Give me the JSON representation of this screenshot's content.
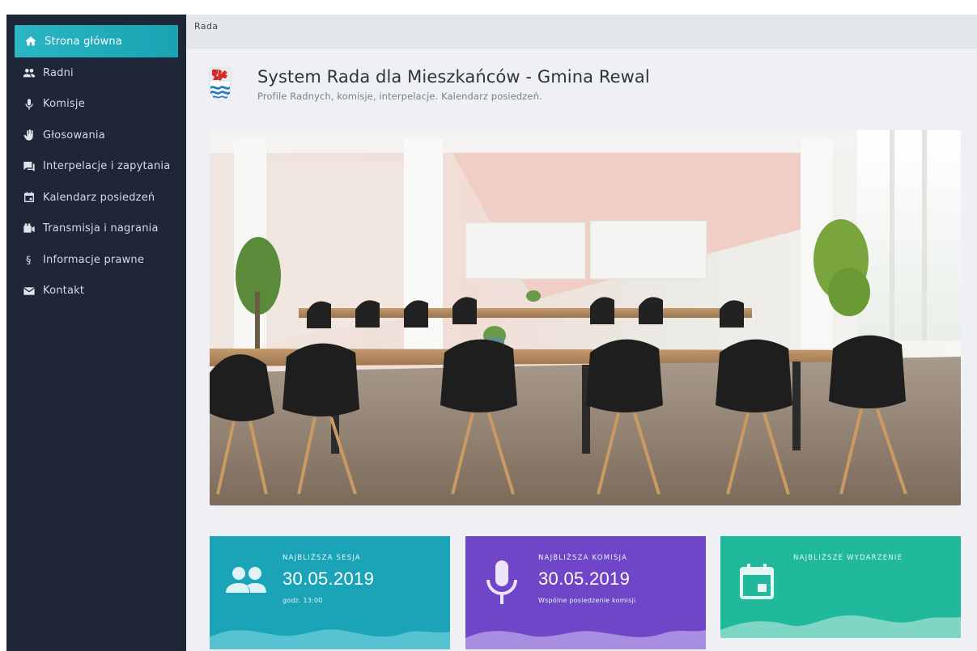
{
  "breadcrumb": "Rada",
  "header": {
    "title": "System Rada dla Mieszkańców - Gmina Rewal",
    "subtitle": "Profile Radnych, komisje, interpelacje. Kalendarz posiedzeń."
  },
  "sidebar": {
    "items": [
      {
        "label": "Strona główna",
        "icon": "home-icon",
        "active": true
      },
      {
        "label": "Radni",
        "icon": "people-icon"
      },
      {
        "label": "Komisje",
        "icon": "microphone-icon"
      },
      {
        "label": "Głosowania",
        "icon": "hand-icon"
      },
      {
        "label": "Interpelacje i zapytania",
        "icon": "chat-icon"
      },
      {
        "label": "Kalendarz posiedzeń",
        "icon": "calendar-icon"
      },
      {
        "label": "Transmisja i nagrania",
        "icon": "video-camera-icon"
      },
      {
        "label": "Informacje prawne",
        "icon": "section-sign-icon"
      },
      {
        "label": "Kontakt",
        "icon": "envelope-icon"
      }
    ]
  },
  "cards": [
    {
      "label": "NAJBLIŻSZA SESJA",
      "date": "30.05.2019",
      "sub": "godz. 13:00",
      "icon": "people-icon",
      "color": "#1ba3b8"
    },
    {
      "label": "NAJBLIŻSZA KOMISJA",
      "date": "30.05.2019",
      "sub": "Wspólne posiedzenie komisji",
      "icon": "microphone-icon",
      "color": "#6f46c7"
    },
    {
      "label": "NAJBLIŻSZE WYDARZENIE",
      "date": "",
      "sub": "",
      "icon": "calendar-icon",
      "color": "#20b99b"
    }
  ],
  "colors": {
    "sidebar_bg": "#1d2738",
    "active_item": "#2ab6c4",
    "main_bg": "#eef0f3"
  }
}
